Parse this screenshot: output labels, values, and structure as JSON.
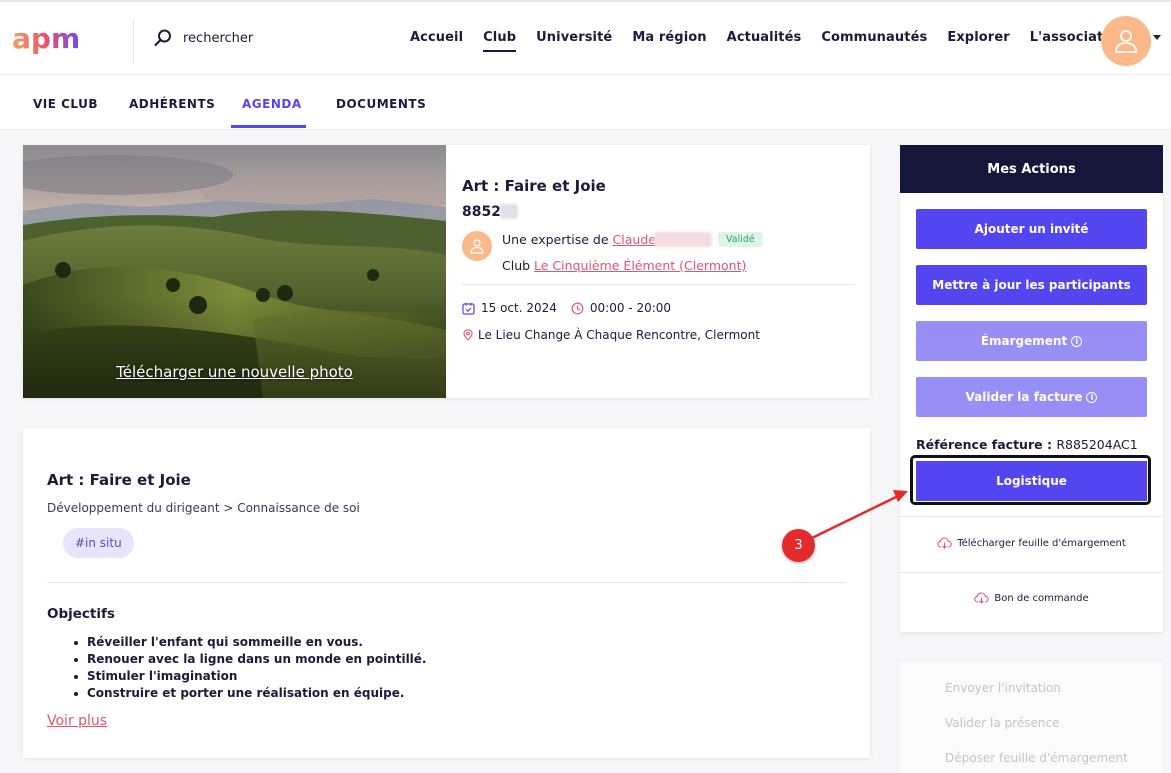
{
  "header": {
    "logo_text": "apm",
    "search_placeholder": "rechercher",
    "nav": [
      "Accueil",
      "Club",
      "Université",
      "Ma région",
      "Actualités",
      "Communautés",
      "Explorer",
      "L'association"
    ],
    "active_nav": "Club"
  },
  "subnav": {
    "tabs": [
      "VIE CLUB",
      "ADHÉRENTS",
      "AGENDA",
      "DOCUMENTS"
    ],
    "active": "AGENDA"
  },
  "event": {
    "upload_link": "Télécharger une nouvelle photo",
    "title": "Art : Faire et Joie",
    "code": "8852",
    "expertise_prefix": "Une expertise de ",
    "expert_name": "Claude",
    "status_badge": "Validé",
    "club_prefix": "Club ",
    "club_name": "Le Cinquième Élément (Clermont)",
    "date": "15 oct. 2024",
    "time": "00:00 - 20:00",
    "location": "Le Lieu Change À Chaque Rencontre, Clermont"
  },
  "description": {
    "title": "Art : Faire et Joie",
    "breadcrumb": "Développement du dirigeant > Connaissance de soi",
    "tag": "#in situ",
    "objectives_title": "Objectifs",
    "objectives": [
      "Réveiller l'enfant qui sommeille en vous.",
      "Renouer avec la ligne dans un monde en pointillé.",
      "Stimuler l'imagination",
      "Construire et porter une réalisation en équipe."
    ],
    "more_link": "Voir plus"
  },
  "actions": {
    "title": "Mes Actions",
    "add_guest": "Ajouter un invité",
    "update_participants": "Mettre à jour les participants",
    "emargement": "Émargement",
    "validate_invoice": "Valider la facture",
    "invoice_ref_label": "Référence facture : ",
    "invoice_ref": "R885204AC1",
    "logistics": "Logistique",
    "download_sheet": "Télécharger feuille d'émargement",
    "purchase_order": "Bon de commande",
    "disabled_items": [
      "Envoyer l'invitation",
      "Valider la présence",
      "Déposer feuille d'émargement"
    ]
  },
  "annotation": {
    "step": "3"
  },
  "colors": {
    "primary": "#5346f0",
    "primary_light": "#978ff6",
    "dark": "#16163a",
    "link": "#e8536b",
    "accent_orange": "#fbb98a",
    "marker": "#e42b2b"
  },
  "icons": [
    "search-icon",
    "user-icon",
    "calendar-icon",
    "clock-icon",
    "location-pin-icon",
    "info-icon",
    "cloud-download-icon"
  ]
}
